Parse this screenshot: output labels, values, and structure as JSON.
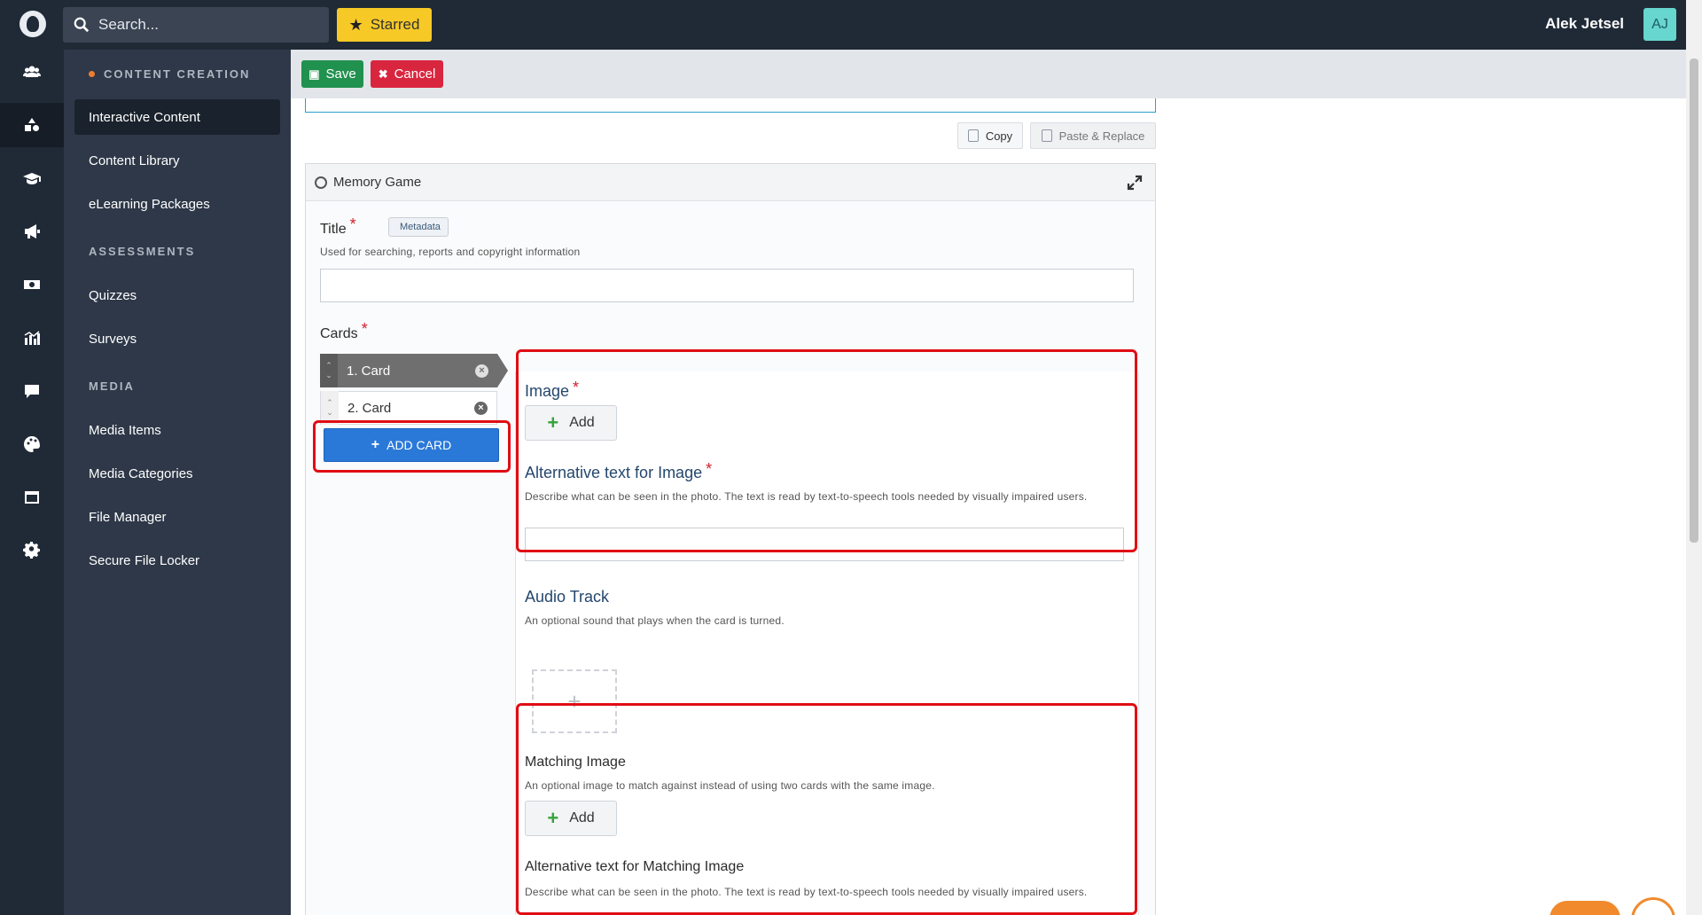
{
  "topbar": {
    "search_placeholder": "Search...",
    "starred_label": "Starred",
    "user_name": "Alek Jetsel",
    "user_initials": "AJ"
  },
  "rail": {
    "items": [
      "users-icon",
      "shapes-icon",
      "graduation-cap-icon",
      "megaphone-icon",
      "money-icon",
      "chart-icon",
      "chat-icon",
      "palette-icon",
      "window-icon",
      "gear-icon"
    ],
    "active_index": 1
  },
  "nav": {
    "sections": [
      {
        "label": "CONTENT CREATION",
        "items": [
          "Interactive Content",
          "Content Library",
          "eLearning Packages"
        ]
      },
      {
        "label": "ASSESSMENTS",
        "items": [
          "Quizzes",
          "Surveys"
        ]
      },
      {
        "label": "MEDIA",
        "items": [
          "Media Items",
          "Media Categories",
          "File Manager",
          "Secure File Locker"
        ]
      }
    ],
    "active_item": "Interactive Content"
  },
  "toolbar": {
    "save_label": "Save",
    "cancel_label": "Cancel"
  },
  "clipboard": {
    "copy_label": "Copy",
    "paste_label": "Paste & Replace"
  },
  "editor": {
    "panel_title": "Memory Game",
    "title_field": {
      "label": "Title",
      "required_mark": "*",
      "badge": "Metadata",
      "description": "Used for searching, reports and copyright information",
      "value": ""
    },
    "cards_label": "Cards",
    "cards_required_mark": "*",
    "cards": [
      {
        "label": "1. Card",
        "active": true
      },
      {
        "label": "2. Card",
        "active": false
      }
    ],
    "add_card_label": "ADD CARD",
    "image": {
      "label": "Image",
      "required_mark": "*",
      "add_label": "Add"
    },
    "alt_image": {
      "label": "Alternative text for Image",
      "required_mark": "*",
      "description": "Describe what can be seen in the photo. The text is read by text-to-speech tools needed by visually impaired users.",
      "value": ""
    },
    "audio": {
      "label": "Audio Track",
      "description": "An optional sound that plays when the card is turned.",
      "placeholder_glyph": "+"
    },
    "matching_image": {
      "label": "Matching Image",
      "description": "An optional image to match against instead of using two cards with the same image.",
      "add_label": "Add"
    },
    "alt_matching": {
      "label": "Alternative text for Matching Image",
      "description": "Describe what can be seen in the photo. The text is read by text-to-speech tools needed by visually impaired users.",
      "value": ""
    }
  },
  "colors": {
    "topbar": "#202a37",
    "nav": "#2e3848",
    "save": "#21914f",
    "cancel": "#d9263f",
    "starred": "#f6c927",
    "add_card": "#2a79d8",
    "highlight": "#e00d14",
    "heading_blue": "#24476d"
  }
}
